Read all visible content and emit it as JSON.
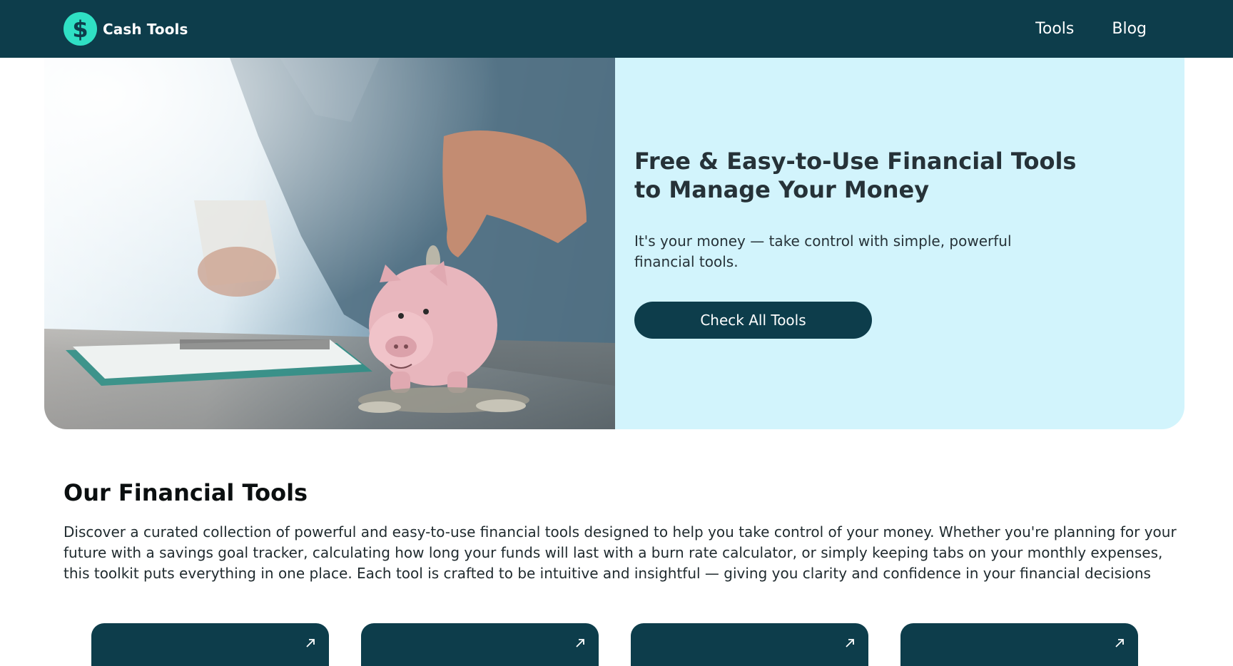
{
  "nav": {
    "brand_logo_symbol": "$",
    "brand_name": "Cash Tools",
    "links": [
      "Tools",
      "Blog"
    ]
  },
  "hero": {
    "image_icon": "piggy-bank-photo",
    "title": "Free & Easy-to-Use Financial Tools to Manage Your Money",
    "subtitle": "It's your money — take control with simple, powerful financial tools.",
    "button_label": "Check All Tools"
  },
  "tools_section": {
    "title": "Our Financial Tools",
    "description": "Discover a curated collection of powerful and easy-to-use financial tools designed to help you take control of your money. Whether you're planning for your future with a savings goal tracker, calculating how long your funds will last with a burn rate calculator, or simply keeping tabs on your monthly expenses, this toolkit puts everything in one place. Each tool is crafted to be intuitive and insightful — giving you clarity and confidence in your financial decisions",
    "cards": [
      {
        "icon": "arrow-up-right-icon"
      },
      {
        "icon": "arrow-up-right-icon"
      },
      {
        "icon": "arrow-up-right-icon"
      },
      {
        "icon": "arrow-up-right-icon"
      }
    ]
  },
  "colors": {
    "navbar": "#0d3d4b",
    "logo_accent": "#2fe0c4",
    "hero_panel": "#d2f4fc",
    "button": "#0d3d4b",
    "card": "#0d3d4b"
  }
}
